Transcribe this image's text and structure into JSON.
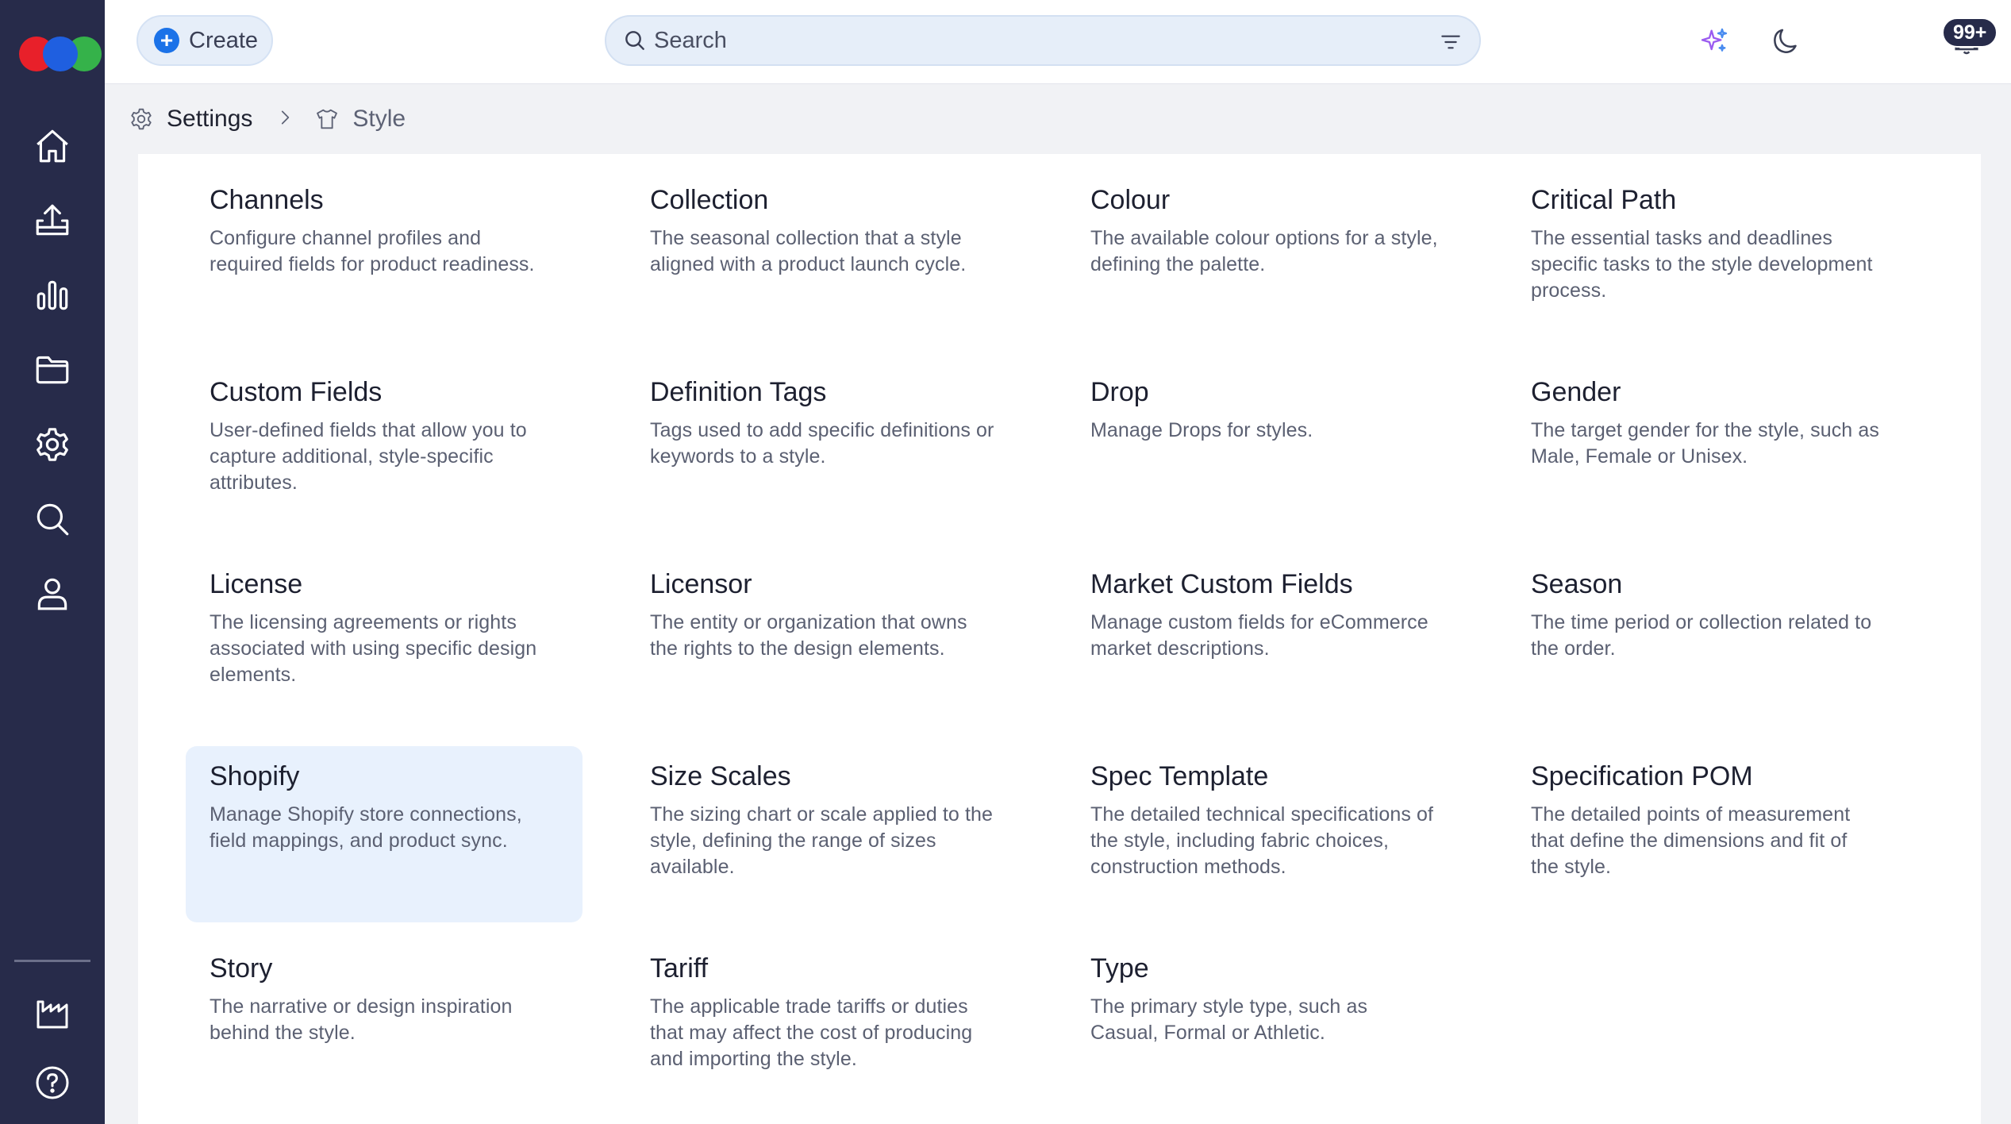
{
  "topbar": {
    "create_label": "Create",
    "search_placeholder": "Search",
    "notification_count": "99+"
  },
  "breadcrumb": {
    "items": [
      "Settings",
      "Style"
    ]
  },
  "sidebar": {
    "items": [
      "home-icon",
      "upload-icon",
      "chart-icon",
      "folder-icon",
      "settings-icon",
      "search-icon",
      "user-icon"
    ],
    "bottom": [
      "factory-icon",
      "help-icon"
    ]
  },
  "colors": {
    "sidebar_bg": "#272b4a",
    "accent": "#1b72e8",
    "selected_card_bg": "#e8f1fd",
    "logo": [
      "#e8202a",
      "#1f5fe0",
      "#35b24a"
    ]
  },
  "cards": [
    {
      "title": "Channels",
      "desc": "Configure channel profiles and required fields for product readiness."
    },
    {
      "title": "Collection",
      "desc": "The seasonal collection that a style aligned with a product launch cycle."
    },
    {
      "title": "Colour",
      "desc": "The available colour options for a style, defining the palette."
    },
    {
      "title": "Critical Path",
      "desc": "The essential tasks and deadlines specific tasks to the style development process."
    },
    {
      "title": "Custom Fields",
      "desc": "User-defined fields that allow you to capture additional, style-specific attributes."
    },
    {
      "title": "Definition Tags",
      "desc": "Tags used to add specific definitions or keywords to a style."
    },
    {
      "title": "Drop",
      "desc": "Manage Drops for styles."
    },
    {
      "title": "Gender",
      "desc": "The target gender for the style, such as Male, Female or Unisex."
    },
    {
      "title": "License",
      "desc": "The licensing agreements or rights associated with using specific design elements."
    },
    {
      "title": "Licensor",
      "desc": "The entity or organization that owns the rights to the design elements."
    },
    {
      "title": "Market Custom Fields",
      "desc": "Manage custom fields for eCommerce market descriptions."
    },
    {
      "title": "Season",
      "desc": "The time period or collection related to the order."
    },
    {
      "title": "Shopify",
      "desc": "Manage Shopify store connections, field mappings, and product sync.",
      "selected": true
    },
    {
      "title": "Size Scales",
      "desc": "The sizing chart or scale applied to the style, defining the range of sizes available."
    },
    {
      "title": "Spec Template",
      "desc": "The detailed technical specifications of the style, including fabric choices, construction methods."
    },
    {
      "title": "Specification POM",
      "desc": "The detailed points of measurement that define the dimensions and fit of the style."
    },
    {
      "title": "Story",
      "desc": "The narrative or design inspiration behind the style."
    },
    {
      "title": "Tariff",
      "desc": "The applicable trade tariffs or duties that may affect the cost of producing and importing the style."
    },
    {
      "title": "Type",
      "desc": "The primary style type, such as Casual, Formal or Athletic."
    }
  ]
}
